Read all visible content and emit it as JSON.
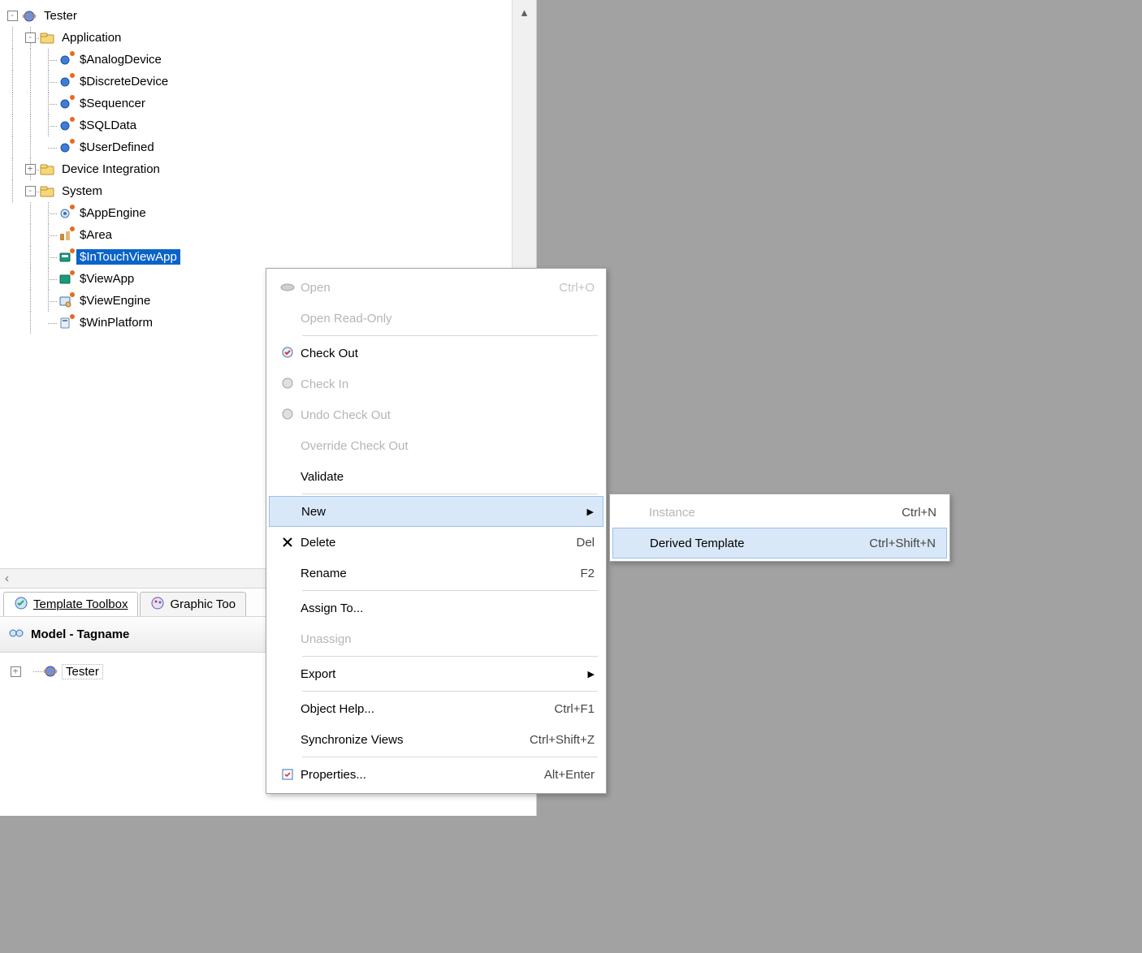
{
  "tree": {
    "root": "Tester",
    "application": {
      "label": "Application",
      "items": [
        "$AnalogDevice",
        "$DiscreteDevice",
        "$Sequencer",
        "$SQLData",
        "$UserDefined"
      ]
    },
    "device_integration": "Device Integration",
    "system": {
      "label": "System",
      "items": [
        "$AppEngine",
        "$Area",
        "$InTouchViewApp",
        "$ViewApp",
        "$ViewEngine",
        "$WinPlatform"
      ]
    }
  },
  "tabs": {
    "template": "Template Toolbox",
    "graphic": "Graphic Too"
  },
  "panel_title": "Model - Tagname",
  "model_root": "Tester",
  "small_arrow": "‹",
  "ctx": {
    "open": "Open",
    "open_s": "Ctrl+O",
    "open_ro": "Open Read-Only",
    "check_out": "Check Out",
    "check_in": "Check In",
    "undo_co": "Undo Check Out",
    "override_co": "Override Check Out",
    "validate": "Validate",
    "new": "New",
    "delete": "Delete",
    "delete_s": "Del",
    "rename": "Rename",
    "rename_s": "F2",
    "assign": "Assign To...",
    "unassign": "Unassign",
    "export": "Export",
    "help": "Object Help...",
    "help_s": "Ctrl+F1",
    "sync": "Synchronize Views",
    "sync_s": "Ctrl+Shift+Z",
    "props": "Properties...",
    "props_s": "Alt+Enter"
  },
  "sub": {
    "instance": "Instance",
    "instance_s": "Ctrl+N",
    "derived": "Derived Template",
    "derived_s": "Ctrl+Shift+N"
  }
}
